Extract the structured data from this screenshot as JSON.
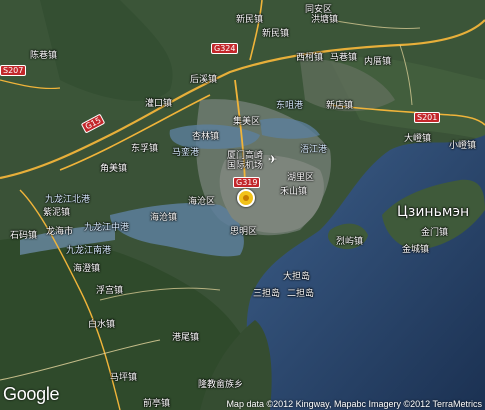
{
  "logo": "Google",
  "attribution": "Map data ©2012 Kingway, Mapabc  Imagery ©2012 TerraMetrics",
  "highway_shields": [
    "G324",
    "G15",
    "S207",
    "S201",
    "G319"
  ],
  "places": {
    "tonganzhen": "同安区",
    "xinminzhen": "新民镇",
    "hongtangzhen": "洪塘镇",
    "xinminzhen2": "新民镇",
    "xilizhen": "西柯镇",
    "maxiangzhen": "马巷镇",
    "neicuozhen": "内厝镇",
    "chenxiangzhen": "陈巷镇",
    "houxizhen": "后溪镇",
    "guanxunzhen": "灌口镇",
    "jimeiqu": "集美区",
    "xinglinzhen": "杏林镇",
    "dongzuigang": "东咀港",
    "xindianzhen": "新店镇",
    "dadengzhen": "大嶝镇",
    "xiaodengzhen": "小嶝镇",
    "dongfuzhen": "东孚镇",
    "maluanzhen": "马銮港",
    "xiamen_airport": "厦门高崎国际机场",
    "huliqu": "湖里区",
    "wujianggang": "浯江港",
    "jiaomeizhen": "角美镇",
    "jiulongjiang_north": "九龙江北港",
    "haicangqu": "海沧区",
    "hemuzhen": "禾山镇",
    "zhiwanzhen": "紫泥镇",
    "jiulongjiang_middle": "九龙江中港",
    "haicangzhen": "海沧镇",
    "simingqu": "思明区",
    "liehuzhen": "烈屿镇",
    "jinmenzhen": "金门镇",
    "jinchengzhen": "金城镇",
    "shimazhen": "石码镇",
    "longhaishi": "龙海市",
    "jiulongjiang_south": "九龙江南港",
    "haichengzhen": "海澄镇",
    "dadan": "大担岛",
    "erdan": "二担岛",
    "sandan": "三担岛",
    "fugongzhen": "浮宫镇",
    "baishuizhen": "白水镇",
    "gangweizhen": "港尾镇",
    "longjiao": "隆教畲族乡",
    "mashizhen": "马坪镇",
    "qianzhen": "前亭镇",
    "jinmen_cyr": "Цзиньмэн",
    "airport_icon": "✈"
  }
}
